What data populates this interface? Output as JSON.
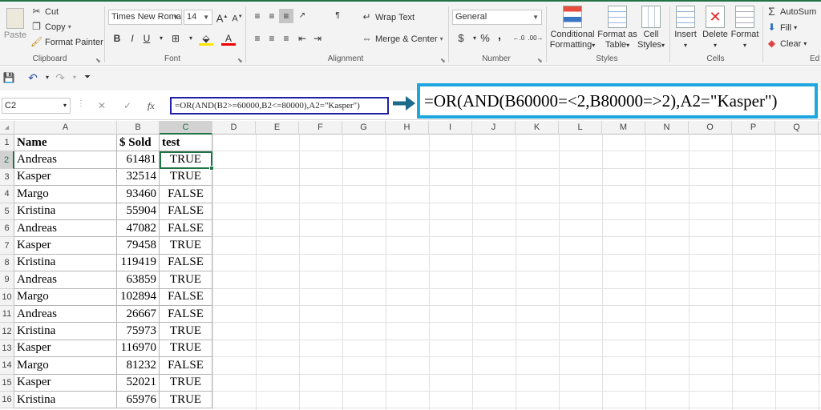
{
  "ribbon": {
    "clipboard": {
      "paste": "Paste",
      "cut": "Cut",
      "copy": "Copy",
      "format_painter": "Format Painter",
      "label": "Clipboard"
    },
    "font": {
      "name": "Times New Roma",
      "size": "14",
      "bold": "B",
      "italic": "I",
      "underline": "U",
      "label": "Font"
    },
    "alignment": {
      "wrap_text": "Wrap Text",
      "merge_center": "Merge & Center",
      "label": "Alignment"
    },
    "number": {
      "format": "General",
      "currency": "$",
      "percent": "%",
      "comma": ",",
      "label": "Number"
    },
    "styles": {
      "conditional": "Conditional",
      "conditional2": "Formatting",
      "format_table": "Format as",
      "format_table2": "Table",
      "cell_styles": "Cell",
      "cell_styles2": "Styles",
      "label": "Styles"
    },
    "cells": {
      "insert": "Insert",
      "delete": "Delete",
      "format": "Format",
      "label": "Cells"
    },
    "editing": {
      "autosum": "AutoSum",
      "fill": "Fill",
      "clear": "Clear",
      "label": "Ed"
    }
  },
  "formula_bar": {
    "name_box": "C2",
    "fx": "fx",
    "formula": "=OR(AND(B2>=60000,B2<=80000),A2=\"Kasper\")",
    "callout": "=OR(AND(B60000=<2,B80000=>2),A2=\"Kasper\")"
  },
  "columns": [
    "A",
    "B",
    "C",
    "D",
    "E",
    "F",
    "G",
    "H",
    "I",
    "J",
    "K",
    "L",
    "M",
    "N",
    "O",
    "P",
    "Q"
  ],
  "header_row": {
    "num": "1",
    "a": "Name",
    "b": "$ Sold",
    "c": "test"
  },
  "rows": [
    {
      "num": "2",
      "name": "Andreas",
      "sold": "61481",
      "test": "TRUE"
    },
    {
      "num": "3",
      "name": "Kasper",
      "sold": "32514",
      "test": "TRUE"
    },
    {
      "num": "4",
      "name": "Margo",
      "sold": "93460",
      "test": "FALSE"
    },
    {
      "num": "5",
      "name": "Kristina",
      "sold": "55904",
      "test": "FALSE"
    },
    {
      "num": "6",
      "name": "Andreas",
      "sold": "47082",
      "test": "FALSE"
    },
    {
      "num": "7",
      "name": "Kasper",
      "sold": "79458",
      "test": "TRUE"
    },
    {
      "num": "8",
      "name": "Kristina",
      "sold": "119419",
      "test": "FALSE"
    },
    {
      "num": "9",
      "name": "Andreas",
      "sold": "63859",
      "test": "TRUE"
    },
    {
      "num": "10",
      "name": "Margo",
      "sold": "102894",
      "test": "FALSE"
    },
    {
      "num": "11",
      "name": "Andreas",
      "sold": "26667",
      "test": "FALSE"
    },
    {
      "num": "12",
      "name": "Kristina",
      "sold": "75973",
      "test": "TRUE"
    },
    {
      "num": "13",
      "name": "Kasper",
      "sold": "116970",
      "test": "TRUE"
    },
    {
      "num": "14",
      "name": "Margo",
      "sold": "81232",
      "test": "FALSE"
    },
    {
      "num": "15",
      "name": "Kasper",
      "sold": "52021",
      "test": "TRUE"
    },
    {
      "num": "16",
      "name": "Kristina",
      "sold": "65976",
      "test": "TRUE"
    }
  ],
  "colors": {
    "excel_green": "#217346",
    "callout_blue": "#1ea6df",
    "formula_box": "#1f1fa8",
    "arrow": "#1b6a8a",
    "selection": "#217346"
  }
}
